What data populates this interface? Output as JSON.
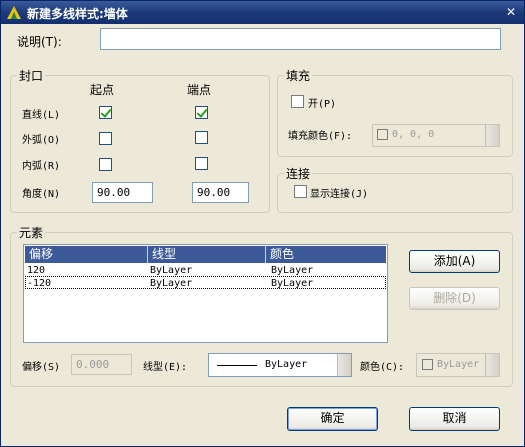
{
  "window": {
    "title": "新建多线样式:墙体",
    "close_glyph": "✕"
  },
  "description": {
    "label": "说明(T):",
    "value": ""
  },
  "caps": {
    "title": "封口",
    "start_header": "起点",
    "end_header": "端点",
    "rows": [
      {
        "label": "直线(L)",
        "start_checked": true,
        "end_checked": true
      },
      {
        "label": "外弧(O)",
        "start_checked": false,
        "end_checked": false
      },
      {
        "label": "内弧(R)",
        "start_checked": false,
        "end_checked": false
      }
    ],
    "angle_label": "角度(N)",
    "angle_start": "90.00",
    "angle_end": "90.00"
  },
  "fill": {
    "title": "填充",
    "on_label": "开(P)",
    "on_checked": false,
    "color_label": "填充颜色(F):",
    "color_value": "0, 0, 0"
  },
  "join": {
    "title": "连接",
    "show_label": "显示连接(J)",
    "show_checked": false
  },
  "elements": {
    "title": "元素",
    "columns": [
      "偏移",
      "线型",
      "颜色"
    ],
    "rows": [
      {
        "offset": "120",
        "linetype": "ByLayer",
        "color": "ByLayer"
      },
      {
        "offset": "-120",
        "linetype": "ByLayer",
        "color": "ByLayer"
      }
    ],
    "add_label": "添加(A)",
    "delete_label": "删除(D)",
    "offset_label": "偏移(S)",
    "offset_value": "0.000",
    "linetype_label": "线型(E):",
    "linetype_value": "ByLayer",
    "color_label": "颜色(C):",
    "color_value": "ByLayer"
  },
  "footer": {
    "ok_label": "确定",
    "cancel_label": "取消"
  }
}
